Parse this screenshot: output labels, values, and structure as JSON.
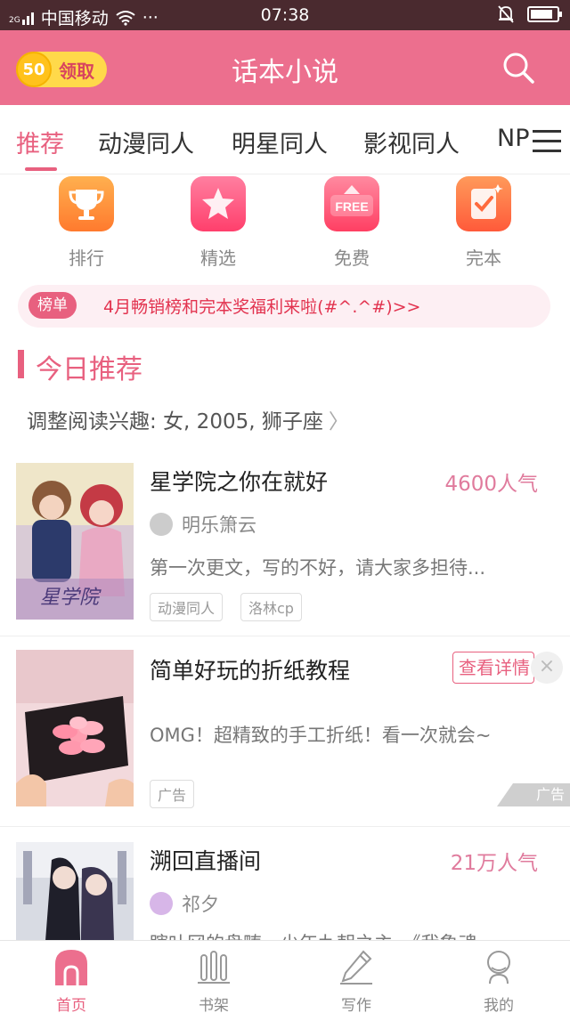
{
  "status_bar": {
    "carrier": "中国移动",
    "signal_tag": "2G",
    "dots": "···",
    "time": "07:38",
    "battery_level": 0.85
  },
  "header": {
    "coin_value": "50",
    "coin_label": "领取",
    "title": "话本小说"
  },
  "tabs": {
    "items": [
      "推荐",
      "动漫同人",
      "明星同人",
      "影视同人",
      "NP"
    ],
    "active_index": 0
  },
  "quick_links": [
    {
      "label": "排行",
      "icon": "trophy-icon",
      "color": "#ff8a3d"
    },
    {
      "label": "精选",
      "icon": "star-icon",
      "color": "#ff4f7a"
    },
    {
      "label": "免费",
      "icon": "free-icon",
      "color": "#ff4f6e",
      "icon_text": "FREE"
    },
    {
      "label": "完本",
      "icon": "check-book-icon",
      "color": "#ff6a3d"
    }
  ],
  "banner": {
    "badge": "榜单",
    "text": "4月畅销榜和完本奖福利来啦(#^.^#)>>"
  },
  "section": {
    "title": "今日推荐",
    "interest": "调整阅读兴趣: 女, 2005, 狮子座",
    "interest_chevron": "〉"
  },
  "items": [
    {
      "title": "星学院之你在就好",
      "popularity": "4600人气",
      "author": "明乐箫云",
      "desc": "第一次更文，写的不好，请大家多担待...",
      "tags": [
        "动漫同人",
        "洛林cp"
      ]
    },
    {
      "title": "简单好玩的折纸教程",
      "detail_button": "查看详情",
      "close": "×",
      "desc": "OMG！超精致的手工折纸！看一次就会~",
      "tags": [
        "广告"
      ],
      "ad_mark": "广告"
    },
    {
      "title": "溯回直播间",
      "popularity": "21万人气",
      "author": "祁夕",
      "desc": "瞎叶冈的盘畴，少年九朝之主，《我象魂"
    }
  ],
  "bottom_nav": [
    {
      "label": "首页",
      "icon": "home-icon",
      "active": true
    },
    {
      "label": "书架",
      "icon": "bookshelf-icon",
      "active": false
    },
    {
      "label": "写作",
      "icon": "pen-icon",
      "active": false
    },
    {
      "label": "我的",
      "icon": "profile-icon",
      "active": false
    }
  ],
  "colors": {
    "brand": "#ec6f8e",
    "accent": "#e8607f",
    "banner_text": "#e2334f"
  }
}
